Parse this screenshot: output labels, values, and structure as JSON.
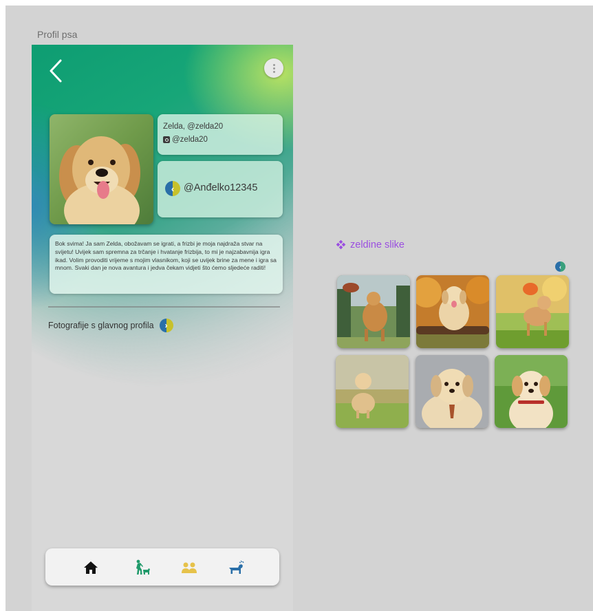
{
  "frame": {
    "title": "Profil psa"
  },
  "profile": {
    "name_handle": "Zelda, @zelda20",
    "instagram": "@zelda20",
    "owner": "@Anđelko12345",
    "bio": "Bok svima! Ja sam Zelda, obožavam se igrati, a frizbi je moja najdraža stvar na svijetu! Uvijek sam spremna za trčanje i hvatanje frizbija, to mi je najzabavnija igra ikad. Volim provoditi vrijeme s mojim vlasnikom, koji se uvijek brine za mene i igra sa mnom. Svaki dan je nova avantura i jedva čekam vidjeti što ćemo sljedeće raditi!",
    "photos_link": "Fotografije s glavnog profila"
  },
  "gallery": {
    "title": "zeldine slike",
    "photos": [
      "dog-catching-frisbee",
      "dog-on-log",
      "dog-jumping-frisbee",
      "puppy-in-grass",
      "puppy-with-tie",
      "puppy-with-collar"
    ]
  },
  "nav": {
    "items": [
      "home-icon",
      "walk-dog-icon",
      "group-icon",
      "dog-icon"
    ],
    "colors": [
      "#111111",
      "#1f9a6a",
      "#e6c24a",
      "#2a6fa8"
    ]
  },
  "colors": {
    "accent_purple": "#9b4fe0",
    "green": "#17a678",
    "blue": "#2a6fa8"
  }
}
